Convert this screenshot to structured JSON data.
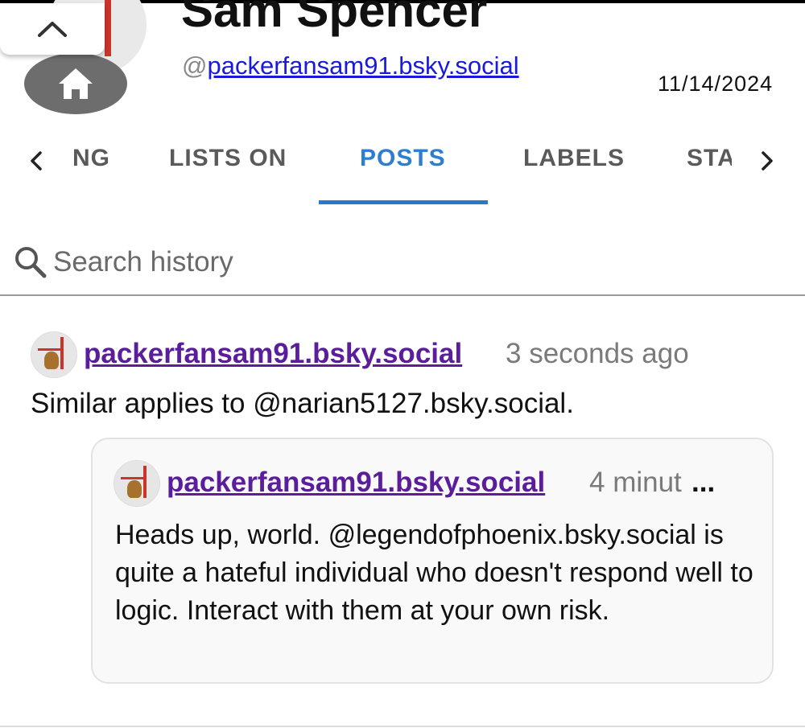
{
  "header": {
    "name": "Sam Spencer",
    "handle_prefix": "@",
    "handle": "packerfansam91.bsky.social",
    "date": "11/14/2024"
  },
  "tabs": {
    "items": [
      {
        "label": "NG"
      },
      {
        "label": "LISTS ON"
      },
      {
        "label": "POSTS"
      },
      {
        "label": "LABELS"
      },
      {
        "label": "STA"
      }
    ],
    "active_color": "#2d7dd2"
  },
  "search": {
    "placeholder": "Search history"
  },
  "post": {
    "author": "packerfansam91.bsky.social",
    "time": "3 seconds ago",
    "text": "Similar applies to @narian5127.bsky.social.",
    "quote": {
      "author": "packerfansam91.bsky.social",
      "time": "4 minut",
      "ellipsis": "...",
      "text": "Heads up, world. @legendofphoenix.bsky.social is quite a hateful individual who doesn't respond well to logic. Interact with them at your own risk."
    }
  },
  "colors": {
    "link": "#1a1ad9",
    "author": "#5a1d9c",
    "accent": "#2a78c8"
  }
}
